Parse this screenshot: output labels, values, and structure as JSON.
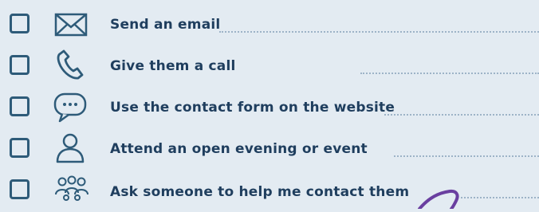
{
  "checklist": {
    "items": [
      {
        "label": "Send an email",
        "icon": "envelope-icon"
      },
      {
        "label": "Give them a call",
        "icon": "phone-icon"
      },
      {
        "label": "Use the contact form on the website",
        "icon": "chat-bubble-icon"
      },
      {
        "label": "Attend an open evening or event",
        "icon": "person-icon"
      },
      {
        "label": "Ask someone to help me contact them",
        "icon": "group-icon"
      }
    ]
  },
  "colors": {
    "background": "#e3ebf2",
    "ink": "#1f3e5e",
    "outline": "#2e5b79",
    "dotted_line": "#9db3c7",
    "pen": "#6a3fa0"
  }
}
